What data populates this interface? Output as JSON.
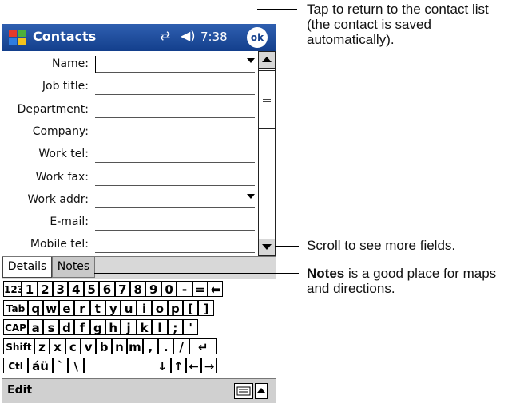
{
  "titlebar": {
    "title": "Contacts",
    "time": "7:38",
    "ok_label": "ok"
  },
  "fields": [
    {
      "label": "Name:",
      "dropdown": true
    },
    {
      "label": "Job title:",
      "dropdown": false
    },
    {
      "label": "Department:",
      "dropdown": false
    },
    {
      "label": "Company:",
      "dropdown": false
    },
    {
      "label": "Work tel:",
      "dropdown": false
    },
    {
      "label": "Work fax:",
      "dropdown": false
    },
    {
      "label": "Work addr:",
      "dropdown": true
    },
    {
      "label": "E-mail:",
      "dropdown": false
    },
    {
      "label": "Mobile tel:",
      "dropdown": false
    }
  ],
  "tabs": {
    "details": "Details",
    "notes": "Notes"
  },
  "keyboard": {
    "rows": [
      [
        "123",
        "1",
        "2",
        "3",
        "4",
        "5",
        "6",
        "7",
        "8",
        "9",
        "0",
        "-",
        "=",
        "⬅"
      ],
      [
        "Tab",
        "q",
        "w",
        "e",
        "r",
        "t",
        "y",
        "u",
        "i",
        "o",
        "p",
        "[",
        "]"
      ],
      [
        "CAP",
        "a",
        "s",
        "d",
        "f",
        "g",
        "h",
        "j",
        "k",
        "l",
        ";",
        "'"
      ],
      [
        "Shift",
        "z",
        "x",
        "c",
        "v",
        "b",
        "n",
        "m",
        ",",
        ".",
        "/",
        "↵"
      ],
      [
        "Ctl",
        "áü",
        "`",
        "\\",
        "↓",
        "↑",
        "←",
        "→"
      ]
    ]
  },
  "menubar": {
    "edit": "Edit"
  },
  "callouts": {
    "ok": "Tap to return to the contact list (the contact is saved automatically).",
    "scroll": "Scroll to see more fields.",
    "notes_bold": "Notes",
    "notes_rest": " is a good place for maps and directions."
  },
  "colors": {
    "title_bar": "#1f4e9c",
    "tab_bar": "#d8d8d8",
    "menu_bar": "#d0d0d0"
  }
}
